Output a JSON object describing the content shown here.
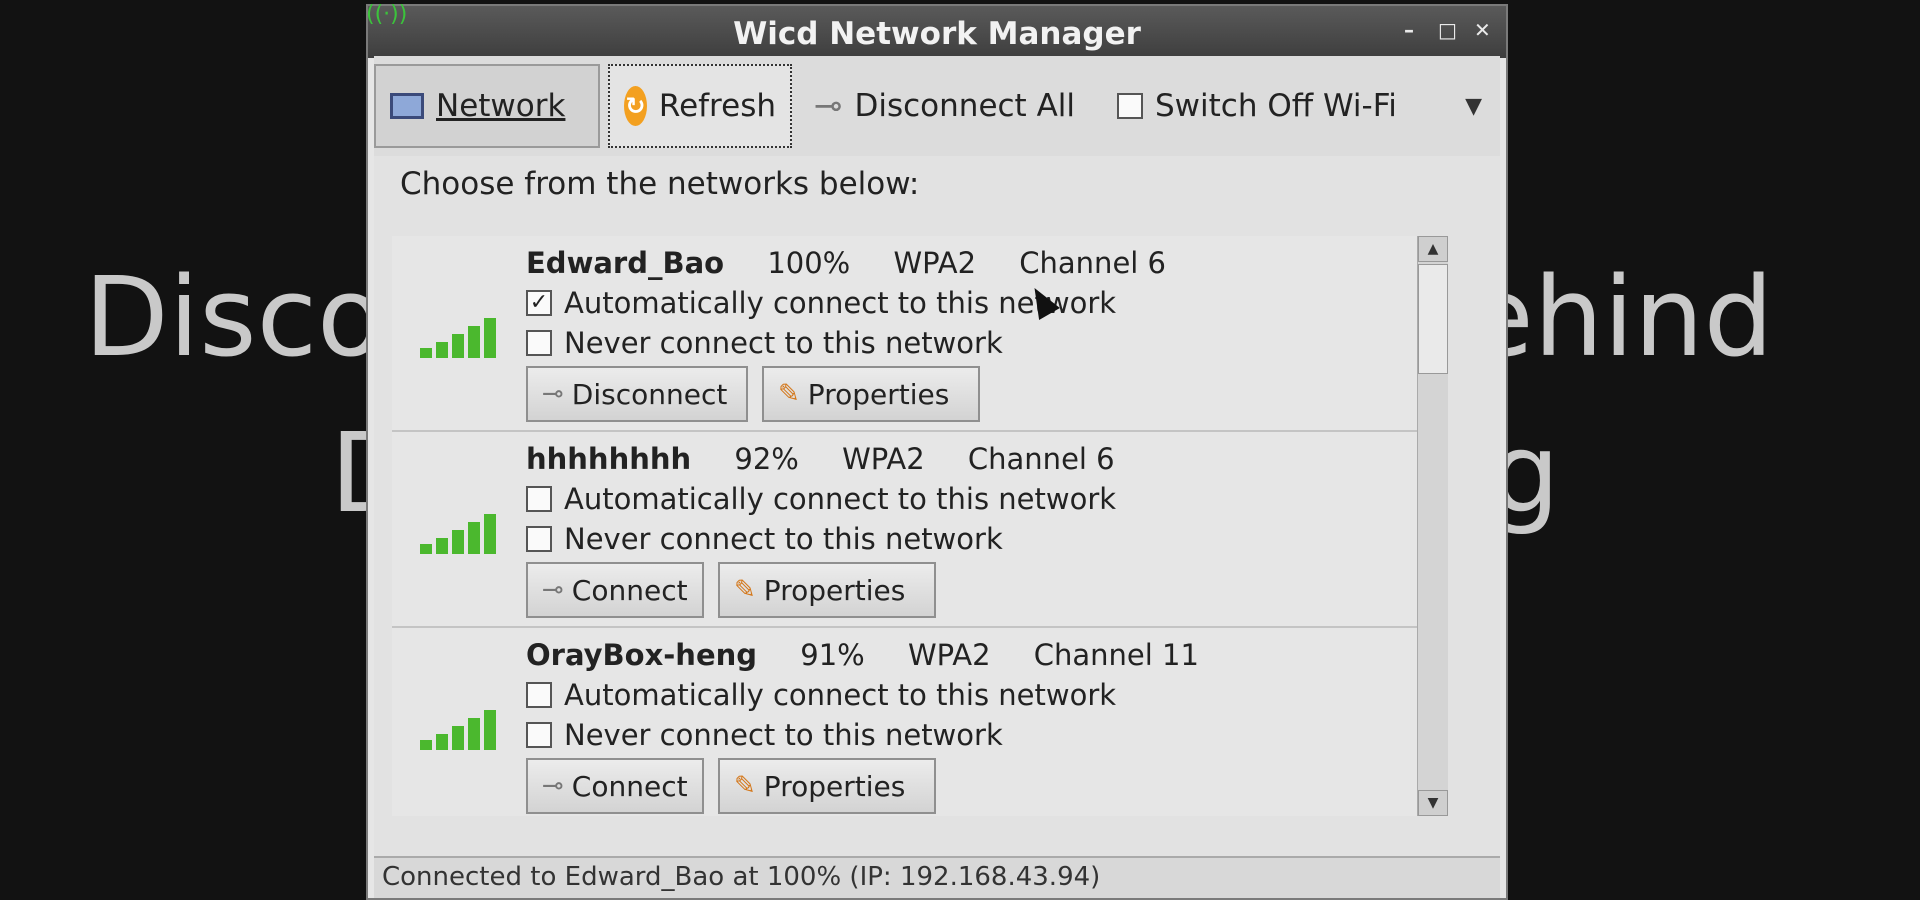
{
  "background": {
    "line1_left": "Disco",
    "line1_right": "ehind",
    "line2_left": "D",
    "line2_right": "g"
  },
  "window": {
    "title": "Wicd Network Manager",
    "controls": {
      "minimize": "–",
      "maximize": "□",
      "close": "✕"
    }
  },
  "toolbar": {
    "network_label": "Network",
    "refresh_label": "Refresh",
    "disconnect_all_label": "Disconnect All",
    "switch_off_wifi_label": "Switch Off Wi-Fi",
    "switch_off_wifi_checked": false
  },
  "content": {
    "choose_label": "Choose from the networks below:"
  },
  "networks": [
    {
      "ssid": "Edward_Bao",
      "strength": "100%",
      "encryption": "WPA2",
      "channel": "Channel 6",
      "auto_connect_label": "Automatically connect to this network",
      "auto_connect_checked": "✓",
      "never_connect_label": "Never connect to this network",
      "never_connect_checked": "",
      "action_label": "Disconnect",
      "properties_label": "Properties"
    },
    {
      "ssid": "hhhhhhhh",
      "strength": "92%",
      "encryption": "WPA2",
      "channel": "Channel 6",
      "auto_connect_label": "Automatically connect to this network",
      "auto_connect_checked": "",
      "never_connect_label": "Never connect to this network",
      "never_connect_checked": "",
      "action_label": "Connect",
      "properties_label": "Properties"
    },
    {
      "ssid": "OrayBox-heng",
      "strength": "91%",
      "encryption": "WPA2",
      "channel": "Channel 11",
      "auto_connect_label": "Automatically connect to this network",
      "auto_connect_checked": "",
      "never_connect_label": "Never connect to this network",
      "never_connect_checked": "",
      "action_label": "Connect",
      "properties_label": "Properties"
    }
  ],
  "status": {
    "text": "Connected to Edward_Bao at 100% (IP: 192.168.43.94)"
  },
  "colors": {
    "signal_green": "#4bb82e",
    "titlebar": "#4a4a4a",
    "refresh_orange": "#f3a020"
  },
  "icons": {
    "network": "network-icon",
    "refresh": "refresh-icon",
    "disconnect_all": "plug-icon",
    "signal": "signal-strength-icon",
    "properties": "pencil-icon"
  }
}
